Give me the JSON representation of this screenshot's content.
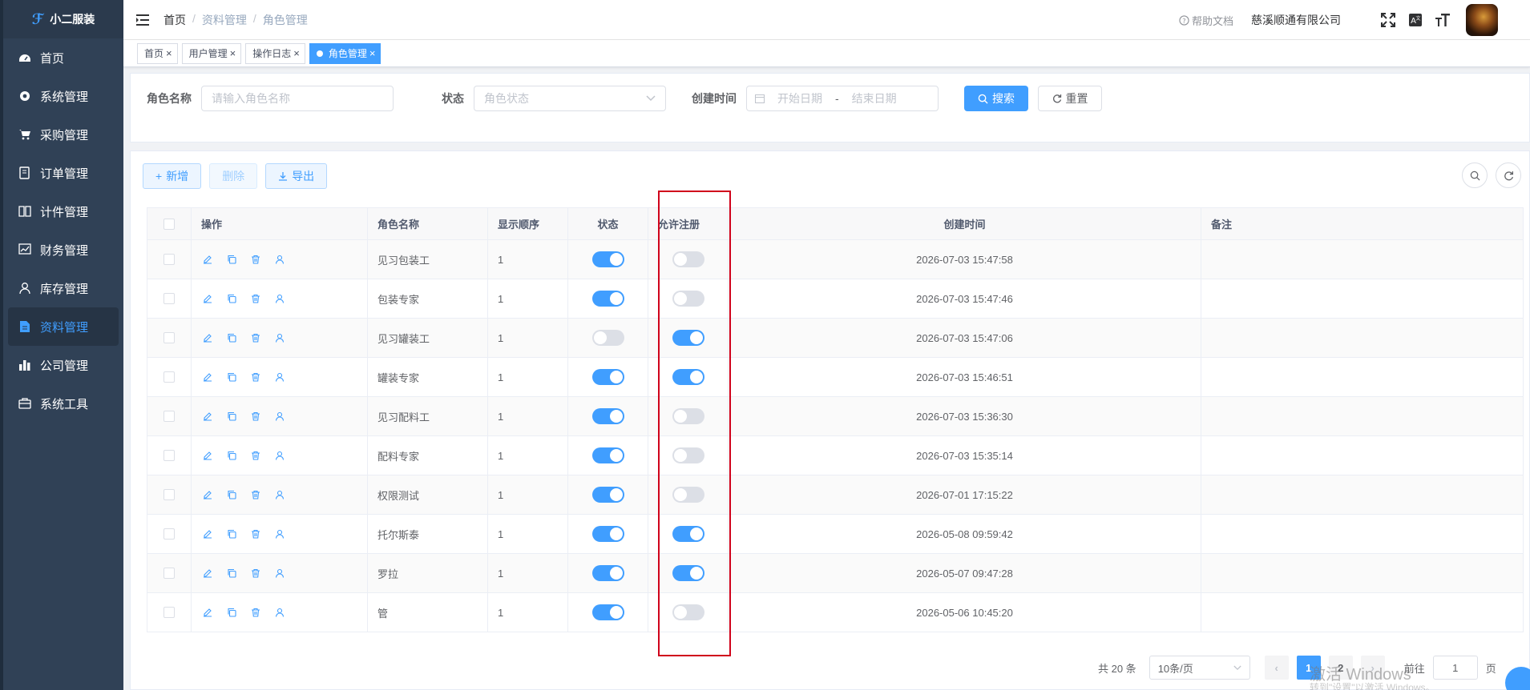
{
  "app": {
    "logo_text": "小二服装"
  },
  "sidebar": {
    "items": [
      {
        "label": "首页",
        "icon": "dashboard-icon"
      },
      {
        "label": "系统管理",
        "icon": "gear-icon"
      },
      {
        "label": "采购管理",
        "icon": "cart-icon"
      },
      {
        "label": "订单管理",
        "icon": "order-icon"
      },
      {
        "label": "计件管理",
        "icon": "book-icon"
      },
      {
        "label": "财务管理",
        "icon": "chart-line-icon"
      },
      {
        "label": "库存管理",
        "icon": "user-icon"
      },
      {
        "label": "资料管理",
        "icon": "document-icon",
        "active": true
      },
      {
        "label": "公司管理",
        "icon": "bar-chart-icon"
      },
      {
        "label": "系统工具",
        "icon": "toolbox-icon"
      }
    ]
  },
  "header": {
    "breadcrumb": [
      "首页",
      "资料管理",
      "角色管理"
    ],
    "help": "帮助文档",
    "company": "慈溪顺通有限公司"
  },
  "tags": [
    {
      "label": "首页",
      "active": false
    },
    {
      "label": "用户管理",
      "active": false
    },
    {
      "label": "操作日志",
      "active": false
    },
    {
      "label": "角色管理",
      "active": true
    }
  ],
  "search": {
    "name_label": "角色名称",
    "name_placeholder": "请输入角色名称",
    "status_label": "状态",
    "status_placeholder": "角色状态",
    "time_label": "创建时间",
    "start_placeholder": "开始日期",
    "range_sep": "-",
    "end_placeholder": "结束日期",
    "search_btn": "搜索",
    "reset_btn": "重置"
  },
  "toolbar": {
    "add": "新增",
    "delete": "删除",
    "export": "导出"
  },
  "table": {
    "headers": {
      "op": "操作",
      "name": "角色名称",
      "order": "显示顺序",
      "status": "状态",
      "reg": "允许注册",
      "time": "创建时间",
      "remark": "备注"
    },
    "rows": [
      {
        "name": "见习包装工",
        "order": "1",
        "status": true,
        "reg": false,
        "time": "2026-07-03 15:47:58",
        "remark": ""
      },
      {
        "name": "包装专家",
        "order": "1",
        "status": true,
        "reg": false,
        "time": "2026-07-03 15:47:46",
        "remark": ""
      },
      {
        "name": "见习罐装工",
        "order": "1",
        "status": false,
        "reg": true,
        "time": "2026-07-03 15:47:06",
        "remark": ""
      },
      {
        "name": "罐装专家",
        "order": "1",
        "status": true,
        "reg": true,
        "time": "2026-07-03 15:46:51",
        "remark": ""
      },
      {
        "name": "见习配料工",
        "order": "1",
        "status": true,
        "reg": false,
        "time": "2026-07-03 15:36:30",
        "remark": ""
      },
      {
        "name": "配料专家",
        "order": "1",
        "status": true,
        "reg": false,
        "time": "2026-07-03 15:35:14",
        "remark": ""
      },
      {
        "name": "权限测试",
        "order": "1",
        "status": true,
        "reg": false,
        "time": "2026-07-01 17:15:22",
        "remark": ""
      },
      {
        "name": "托尔斯泰",
        "order": "1",
        "status": true,
        "reg": true,
        "time": "2026-05-08 09:59:42",
        "remark": ""
      },
      {
        "name": "罗拉",
        "order": "1",
        "status": true,
        "reg": true,
        "time": "2026-05-07 09:47:28",
        "remark": ""
      },
      {
        "name": "管",
        "order": "1",
        "status": true,
        "reg": false,
        "time": "2026-05-06 10:45:20",
        "remark": ""
      }
    ]
  },
  "pagination": {
    "total": "共 20 条",
    "page_size": "10条/页",
    "pages": [
      "1",
      "2"
    ],
    "current": "1",
    "goto_label": "前往",
    "goto_value": "1",
    "page_suffix": "页"
  },
  "overlay": {
    "watermark": "激活 Windows",
    "watermark_sub": "转到\"设置\"以激活 Windows。"
  },
  "colors": {
    "primary": "#409eff",
    "sidebar": "#304156",
    "highlight": "#d0021b"
  }
}
